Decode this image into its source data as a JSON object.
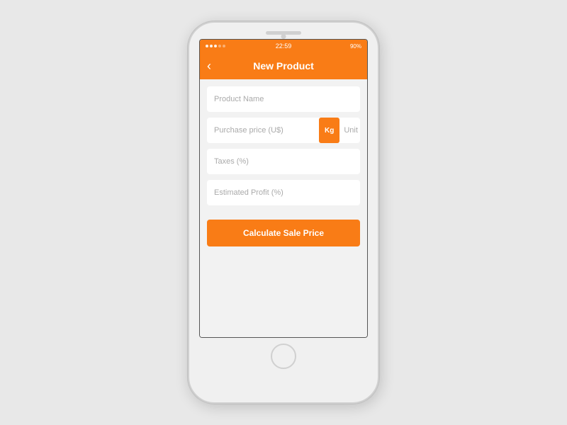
{
  "statusBar": {
    "time": "22:59",
    "battery": "90%"
  },
  "nav": {
    "title": "New Product",
    "back_label": "‹"
  },
  "form": {
    "productName_placeholder": "Product Name",
    "purchasePrice_placeholder": "Purchase price (U$)",
    "kg_label": "Kg",
    "unit_label": "Unit",
    "taxes_placeholder": "Taxes (%)",
    "estimatedProfit_placeholder": "Estimated Profit (%)"
  },
  "button": {
    "calculate_label": "Calculate Sale Price"
  }
}
